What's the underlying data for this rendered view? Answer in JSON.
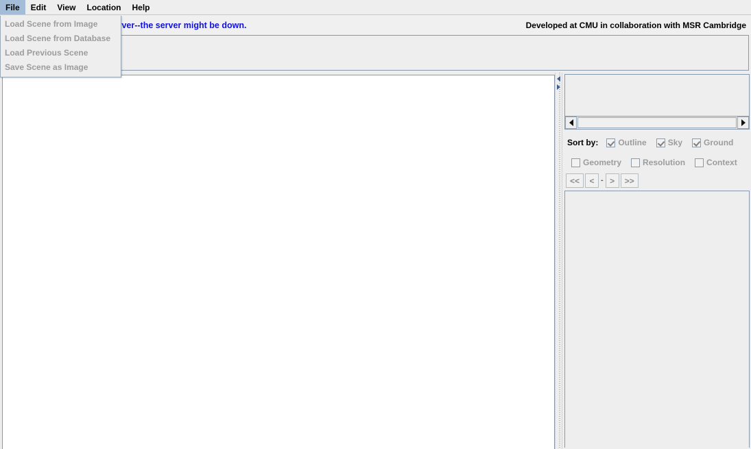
{
  "menubar": {
    "items": [
      {
        "label": "File",
        "selected": true
      },
      {
        "label": "Edit",
        "selected": false
      },
      {
        "label": "View",
        "selected": false
      },
      {
        "label": "Location",
        "selected": false
      },
      {
        "label": "Help",
        "selected": false
      }
    ]
  },
  "file_menu": {
    "items": [
      {
        "label": "Load Scene from Image",
        "disabled": true
      },
      {
        "label": "Load Scene from Database",
        "disabled": true
      },
      {
        "label": "Load Previous Scene",
        "disabled": true
      },
      {
        "label": "Save Scene as Image",
        "disabled": true
      }
    ]
  },
  "status": {
    "message": "Could not connect to the server--the server might be down.",
    "message_color": "#1212dd",
    "credit": "Developed at CMU in collaboration with MSR Cambridge"
  },
  "sort": {
    "label": "Sort by:",
    "checkboxes": [
      {
        "label": "Outline",
        "checked": true,
        "disabled": true
      },
      {
        "label": "Sky",
        "checked": true,
        "disabled": true
      },
      {
        "label": "Ground",
        "checked": true,
        "disabled": true
      },
      {
        "label": "Geometry",
        "checked": false,
        "disabled": true
      },
      {
        "label": "Resolution",
        "checked": false,
        "disabled": true
      },
      {
        "label": "Context",
        "checked": false,
        "disabled": true
      }
    ]
  },
  "navigation": {
    "first_label": "<<",
    "prev_label": "<",
    "separator_label": "-",
    "next_label": ">",
    "last_label": ">>"
  },
  "icons": {
    "scroll_left": "scroll-left-arrow-icon",
    "scroll_right": "scroll-right-arrow-icon",
    "splitter_collapse_left": "splitter-collapse-left-icon",
    "splitter_collapse_right": "splitter-collapse-right-icon"
  },
  "colors": {
    "window_bg": "#eeeeee",
    "canvas_bg": "#ffffff",
    "menu_selected": "#a3bdd8",
    "panel_border": "#8899ab",
    "disabled_text": "#9c9c9c"
  }
}
